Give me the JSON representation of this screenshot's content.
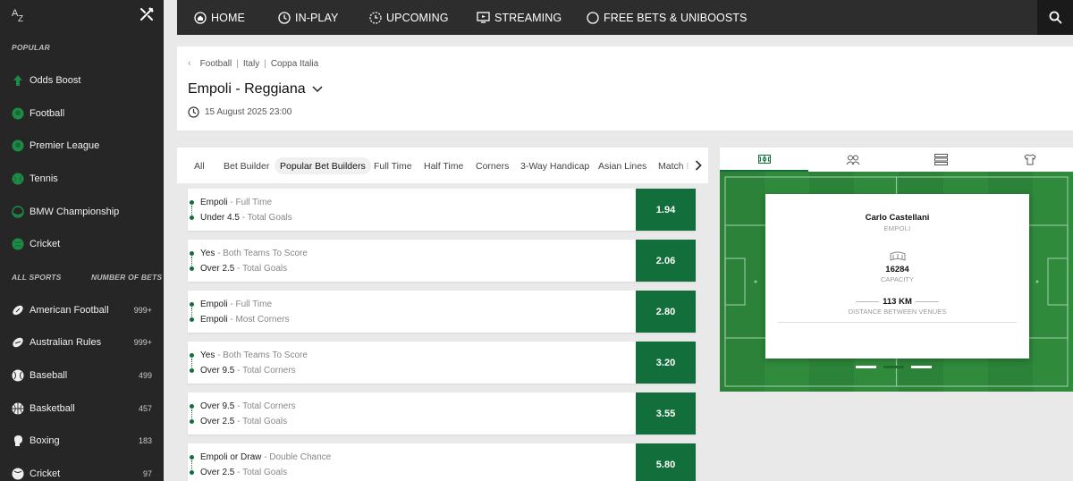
{
  "sidebar": {
    "popular_heading": "POPULAR",
    "popular": [
      {
        "label": "Odds Boost",
        "icon": "odds-boost-icon"
      },
      {
        "label": "Football",
        "icon": "football-icon"
      },
      {
        "label": "Premier League",
        "icon": "premier-league-icon"
      },
      {
        "label": "Tennis",
        "icon": "tennis-icon"
      },
      {
        "label": "BMW Championship",
        "icon": "golf-icon"
      },
      {
        "label": "Cricket",
        "icon": "cricket-icon"
      }
    ],
    "all_sports_heading": "ALL SPORTS",
    "number_of_bets_heading": "NUMBER OF BETS",
    "sports": [
      {
        "label": "American Football",
        "count": "999+",
        "icon": "american-football-icon"
      },
      {
        "label": "Australian Rules",
        "count": "999+",
        "icon": "australian-rules-icon"
      },
      {
        "label": "Baseball",
        "count": "499",
        "icon": "baseball-icon"
      },
      {
        "label": "Basketball",
        "count": "457",
        "icon": "basketball-icon"
      },
      {
        "label": "Boxing",
        "count": "183",
        "icon": "boxing-icon"
      },
      {
        "label": "Cricket",
        "count": "97",
        "icon": "cricket-icon"
      }
    ]
  },
  "nav": {
    "home": "HOME",
    "in_play": "IN-PLAY",
    "upcoming": "UPCOMING",
    "streaming": "STREAMING",
    "free_bets": "FREE BETS & UNIBOOSTS"
  },
  "event": {
    "breadcrumb": [
      "Football",
      "Italy",
      "Coppa Italia"
    ],
    "title": "Empoli - Reggiana",
    "datetime": "15 August 2025 23:00"
  },
  "tabs": [
    "All",
    "Bet Builder",
    "Popular Bet Builders",
    "Full Time",
    "Half Time",
    "Corners",
    "3-Way Handicap",
    "Asian Lines",
    "Match E"
  ],
  "active_tab": "Popular Bet Builders",
  "bets": [
    {
      "legs": [
        {
          "sel": "Empoli",
          "market": "Full Time"
        },
        {
          "sel": "Under 4.5",
          "market": "Total Goals"
        }
      ],
      "odds": "1.94"
    },
    {
      "legs": [
        {
          "sel": "Yes",
          "market": "Both Teams To Score"
        },
        {
          "sel": "Over 2.5",
          "market": "Total Goals"
        }
      ],
      "odds": "2.06"
    },
    {
      "legs": [
        {
          "sel": "Empoli",
          "market": "Full Time"
        },
        {
          "sel": "Empoli",
          "market": "Most Corners"
        }
      ],
      "odds": "2.80"
    },
    {
      "legs": [
        {
          "sel": "Yes",
          "market": "Both Teams To Score"
        },
        {
          "sel": "Over 9.5",
          "market": "Total Corners"
        }
      ],
      "odds": "3.20"
    },
    {
      "legs": [
        {
          "sel": "Over 9.5",
          "market": "Total Corners"
        },
        {
          "sel": "Over 2.5",
          "market": "Total Goals"
        }
      ],
      "odds": "3.55"
    },
    {
      "legs": [
        {
          "sel": "Empoli or Draw",
          "market": "Double Chance"
        },
        {
          "sel": "Over 2.5",
          "market": "Total Goals"
        }
      ],
      "odds": "5.80"
    }
  ],
  "venue": {
    "stadium": "Carlo Castellani",
    "team": "EMPOLI",
    "capacity": "16284",
    "capacity_label": "CAPACITY",
    "distance": "113 KM",
    "distance_label": "DISTANCE BETWEEN VENUES"
  },
  "colors": {
    "accent": "#126e3a",
    "pitch": "#2f8a3c",
    "sidebar": "#262626",
    "topnav": "#2d2d2d"
  }
}
